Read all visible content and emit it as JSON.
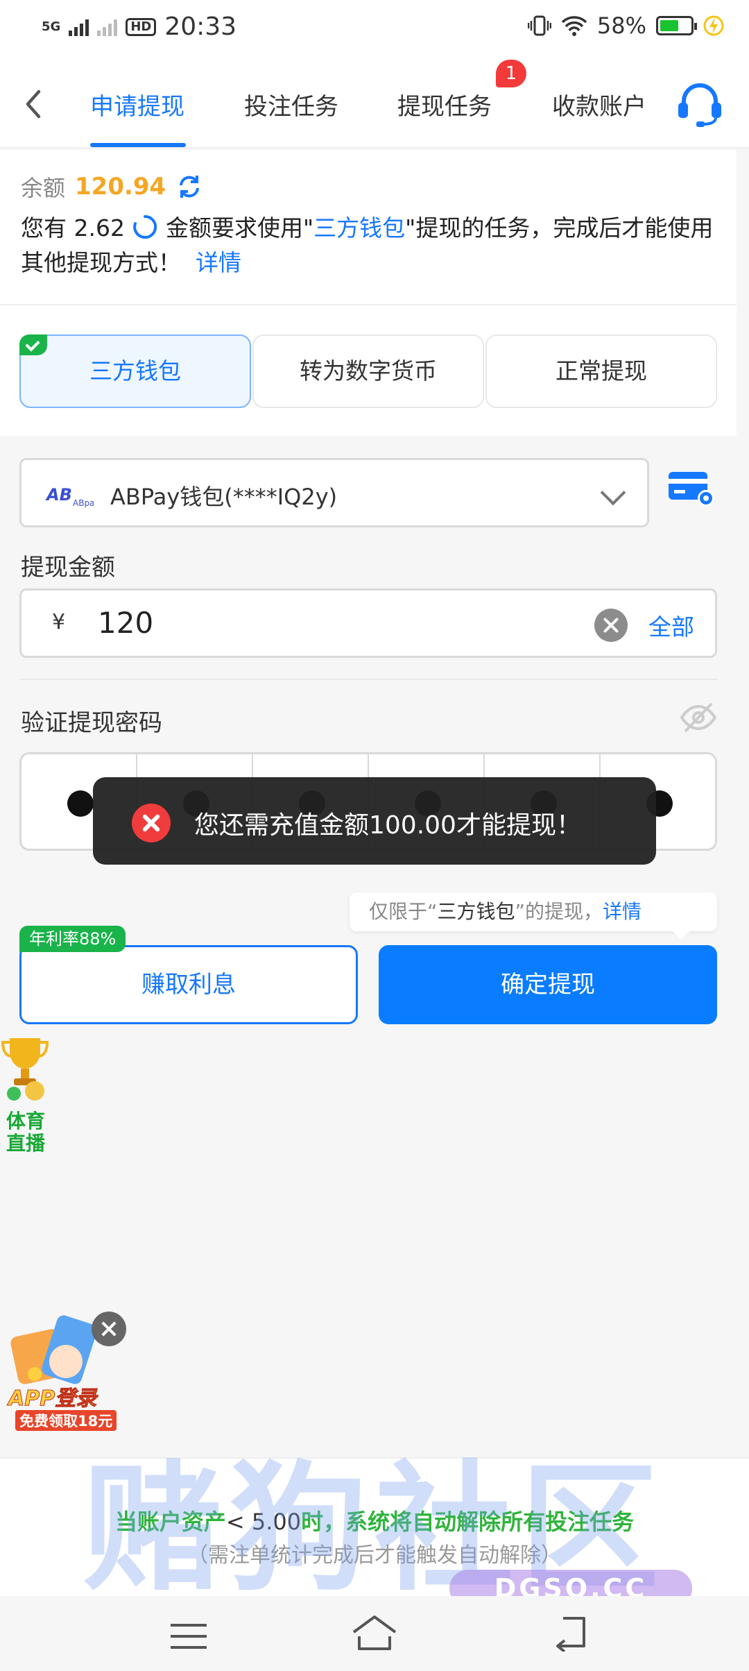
{
  "status_bar": {
    "network": "5G",
    "time": "20:33",
    "battery": "58%",
    "battery_level": 0.58,
    "hd": "HD"
  },
  "header": {
    "tabs": [
      {
        "label": "申请提现"
      },
      {
        "label": "投注任务"
      },
      {
        "label": "提现任务",
        "badge": "1"
      },
      {
        "label": "收款账户"
      }
    ]
  },
  "balance": {
    "label": "余额",
    "value": "120.94",
    "notice_prefix": "您有 2.62",
    "notice_mid": " 金额要求使用\"",
    "notice_highlight": "三方钱包",
    "notice_suffix": "\"提现的任务，完成后才能使用其他提现方式！",
    "notice_link": "详情"
  },
  "methods": [
    {
      "label": "三方钱包"
    },
    {
      "label": "转为数字货币"
    },
    {
      "label": "正常提现"
    }
  ],
  "wallet_select": {
    "value": "ABPay钱包(****IQ2y)",
    "logo": "ABpay"
  },
  "amount": {
    "label": "提现金额",
    "currency": "¥",
    "value": "120",
    "all_label": "全部"
  },
  "password": {
    "label": "验证提现密码",
    "digits_entered": 6
  },
  "toast": {
    "message": "您还需充值金额100.00才能提现！"
  },
  "tip": {
    "prefix": "仅限于“",
    "highlight": "三方钱包",
    "suffix": "”的提现，",
    "link": "详情"
  },
  "buttons": {
    "rate_tag": "年利率88%",
    "earn": "赚取利息",
    "confirm": "确定提现"
  },
  "float_sports": {
    "label": "体育直播"
  },
  "float_app": {
    "title": "APP登录",
    "subtitle": "免费领取18元"
  },
  "bottom_banner": {
    "line1_a": "当账户资产",
    "line1_b": "< 5.00",
    "line1_c": "时，系统将自动解除所有投注任务",
    "line2": "（需注单统计完成后才能触发自动解除）"
  },
  "watermark": {
    "text": "赌狗社区",
    "domain": "DGSQ.CC"
  },
  "colors": {
    "accent": "#1677ff",
    "balance": "#f5a623",
    "success": "#19b34a",
    "error": "#f03c3c"
  }
}
